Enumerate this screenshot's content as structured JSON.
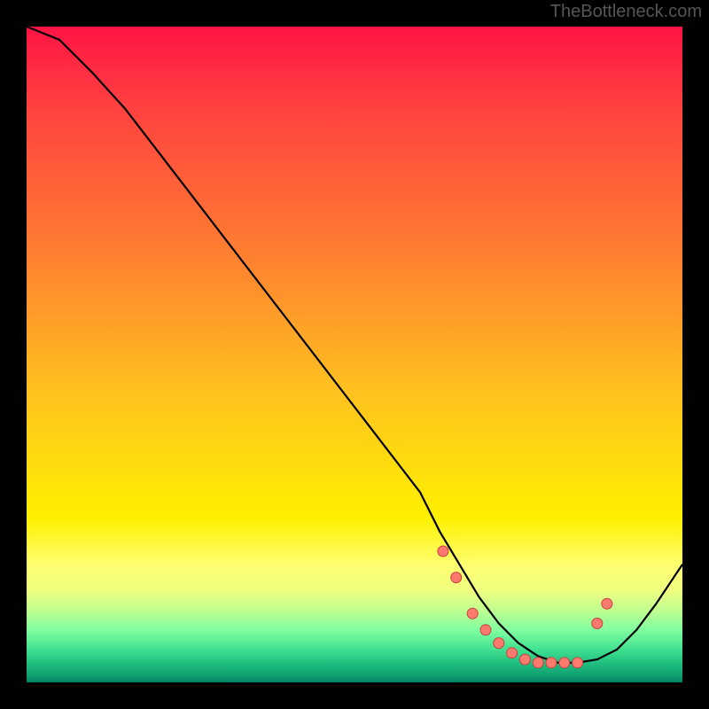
{
  "attribution": "TheBottleneck.com",
  "chart_data": {
    "type": "line",
    "title": "",
    "xlabel": "",
    "ylabel": "",
    "xlim": [
      0,
      100
    ],
    "ylim": [
      0,
      100
    ],
    "series": [
      {
        "name": "curve",
        "x": [
          0,
          5,
          10,
          15,
          20,
          25,
          30,
          35,
          40,
          45,
          50,
          55,
          60,
          63,
          66,
          69,
          72,
          75,
          78,
          81,
          84,
          87,
          90,
          93,
          96,
          100
        ],
        "y": [
          100,
          98,
          93,
          87.5,
          81,
          74.5,
          68,
          61.5,
          55,
          48.5,
          42,
          35.5,
          29,
          23,
          18,
          13,
          9,
          6,
          4,
          3,
          3,
          3.5,
          5,
          8,
          12,
          18
        ]
      }
    ],
    "markers": {
      "name": "dots",
      "x": [
        63.5,
        65.5,
        68,
        70,
        72,
        74,
        76,
        78,
        80,
        82,
        84,
        87,
        88.5
      ],
      "y": [
        20,
        16,
        10.5,
        8,
        6,
        4.5,
        3.5,
        3,
        3,
        3,
        3,
        9,
        12
      ]
    }
  }
}
